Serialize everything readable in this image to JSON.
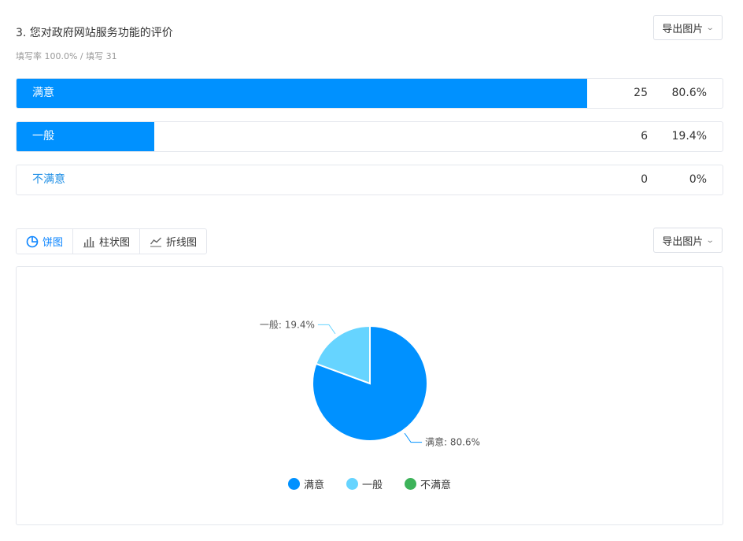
{
  "question": {
    "title": "3. 您对政府网站服务功能的评价",
    "subtitle": "填写率 100.0% / 填写 31"
  },
  "export_label": "导出图片",
  "options": [
    {
      "label": "满意",
      "count": "25",
      "percent": "80.6%",
      "fraction": 0.806
    },
    {
      "label": "一般",
      "count": "6",
      "percent": "19.4%",
      "fraction": 0.194
    },
    {
      "label": "不满意",
      "count": "0",
      "percent": "0%",
      "fraction": 0
    }
  ],
  "tabs": [
    {
      "label": "饼图",
      "icon": "pie-chart-icon",
      "active": true
    },
    {
      "label": "柱状图",
      "icon": "bar-chart-icon",
      "active": false
    },
    {
      "label": "折线图",
      "icon": "line-chart-icon",
      "active": false
    }
  ],
  "colors": {
    "accent": "#0091ff",
    "satisfied": "#0091ff",
    "neutral": "#66d4ff",
    "unsatisfied": "#3db35a"
  },
  "chart_data": {
    "type": "pie",
    "categories": [
      "满意",
      "一般",
      "不满意"
    ],
    "values": [
      80.6,
      19.4,
      0
    ],
    "data_labels": [
      "满意: 80.6%",
      "一般: 19.4%"
    ],
    "legend": [
      "满意",
      "一般",
      "不满意"
    ],
    "legend_position": "bottom"
  }
}
